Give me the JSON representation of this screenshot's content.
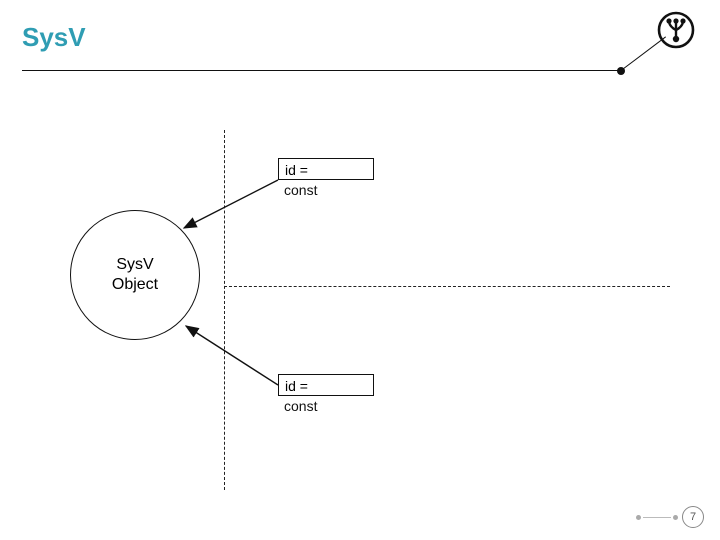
{
  "title": "SysV",
  "circle_label": "SysV\nObject",
  "box_top": {
    "line1": "id =",
    "line2": "const"
  },
  "box_bottom": {
    "line1": "id =",
    "line2": "const"
  },
  "page_number": "7"
}
